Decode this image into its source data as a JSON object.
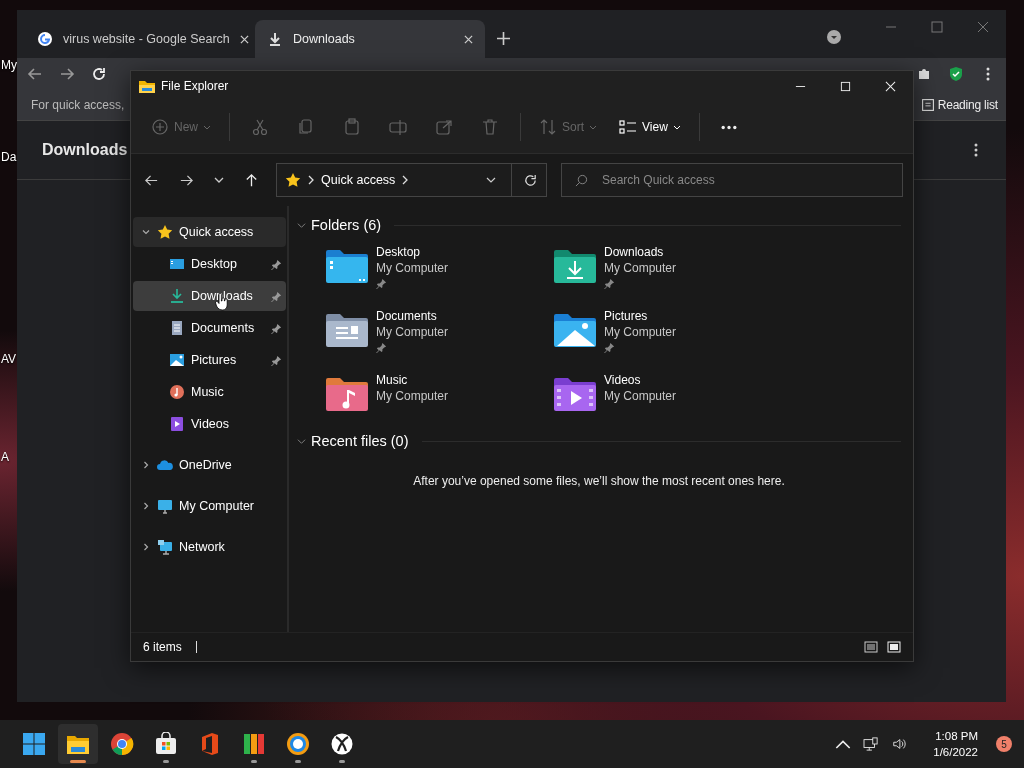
{
  "desktop": {
    "icon_labels": [
      "My",
      "Da",
      "AV",
      "A"
    ]
  },
  "browser": {
    "tabs": [
      {
        "title": "virus website - Google Search",
        "kind": "google",
        "selected": false
      },
      {
        "title": "Downloads",
        "kind": "download",
        "selected": true
      }
    ],
    "bookmarks_hint": "For quick access,",
    "reading_list": "Reading list",
    "page_title": "Downloads"
  },
  "explorer": {
    "title": "File Explorer",
    "toolbar": [
      {
        "kind": "new",
        "label": "New",
        "disabled": true
      },
      {
        "kind": "cut",
        "disabled": true
      },
      {
        "kind": "copy",
        "disabled": true
      },
      {
        "kind": "paste",
        "disabled": true
      },
      {
        "kind": "rename",
        "disabled": true
      },
      {
        "kind": "share",
        "disabled": true
      },
      {
        "kind": "delete",
        "disabled": true
      },
      {
        "kind": "sort",
        "label": "Sort",
        "disabled": true
      },
      {
        "kind": "view",
        "label": "View",
        "disabled": false
      }
    ],
    "address": "Quick access",
    "search": {
      "placeholder": "Search Quick access"
    },
    "sidebar": [
      {
        "label": "Quick access",
        "kind": "star",
        "expanded": true,
        "selected": false,
        "children": [
          {
            "label": "Desktop",
            "kind": "desktop",
            "pinned": true,
            "selected": false
          },
          {
            "label": "Downloads",
            "kind": "downloads",
            "pinned": true,
            "selected": true
          },
          {
            "label": "Documents",
            "kind": "documents",
            "pinned": true,
            "selected": false
          },
          {
            "label": "Pictures",
            "kind": "pictures",
            "pinned": true,
            "selected": false
          },
          {
            "label": "Music",
            "kind": "music",
            "selected": false
          },
          {
            "label": "Videos",
            "kind": "videos",
            "selected": false
          }
        ]
      },
      {
        "label": "OneDrive",
        "kind": "cloud",
        "expanded": false,
        "selected": false
      },
      {
        "label": "My Computer",
        "kind": "computer",
        "expanded": false,
        "selected": false
      },
      {
        "label": "Network",
        "kind": "network",
        "expanded": false,
        "selected": false
      }
    ],
    "sections": [
      {
        "title": "Folders (6)",
        "expanded": true,
        "items": [
          {
            "name": "Desktop",
            "location": "My Computer",
            "kind": "desktop",
            "pinned": true
          },
          {
            "name": "Downloads",
            "location": "My Computer",
            "kind": "downloads",
            "pinned": true
          },
          {
            "name": "Documents",
            "location": "My Computer",
            "kind": "documents",
            "pinned": true
          },
          {
            "name": "Pictures",
            "location": "My Computer",
            "kind": "pictures",
            "pinned": true
          },
          {
            "name": "Music",
            "location": "My Computer",
            "kind": "music"
          },
          {
            "name": "Videos",
            "location": "My Computer",
            "kind": "videos"
          }
        ]
      },
      {
        "title": "Recent files (0)",
        "expanded": true,
        "message": "After you’ve opened some files, we’ll show the most recent ones here."
      }
    ],
    "status": "6 items"
  },
  "taskbar": {
    "apps": [
      {
        "kind": "start",
        "running": false,
        "active": false
      },
      {
        "kind": "explorer",
        "running": true,
        "active": true
      },
      {
        "kind": "chrome",
        "running": false,
        "active": false
      },
      {
        "kind": "store",
        "running": true,
        "active": false
      },
      {
        "kind": "office",
        "running": false,
        "active": false
      },
      {
        "kind": "avg",
        "running": true,
        "active": false
      },
      {
        "kind": "avgbrowser",
        "running": true,
        "active": false
      },
      {
        "kind": "xbox",
        "running": true,
        "active": false
      }
    ],
    "time": "1:08 PM",
    "date": "1/6/2022",
    "notifications": "5"
  }
}
